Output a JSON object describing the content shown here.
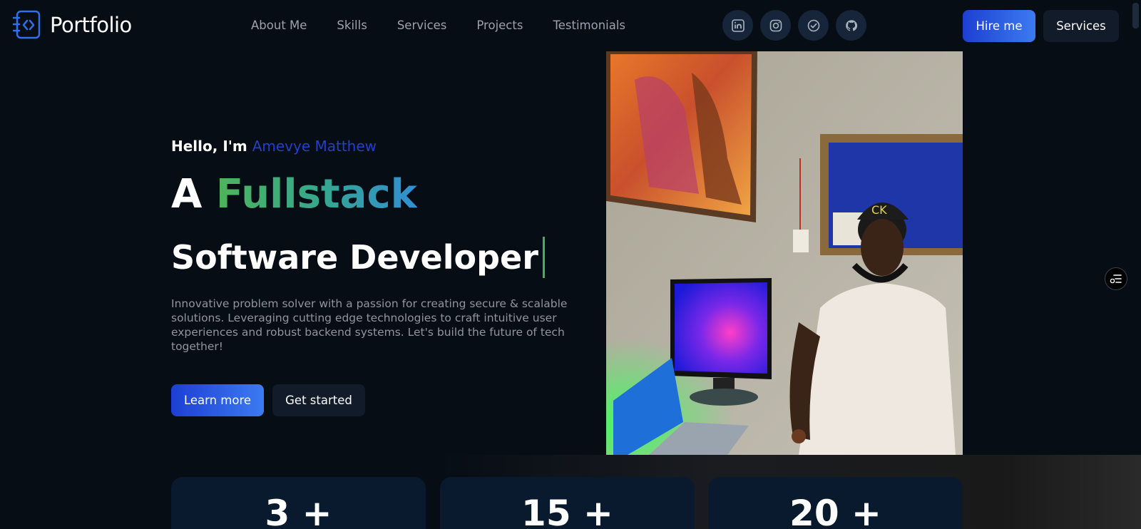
{
  "brand": {
    "name": "Portfolio",
    "icon": "code-file-icon"
  },
  "nav": {
    "items": [
      {
        "label": "About Me"
      },
      {
        "label": "Skills"
      },
      {
        "label": "Services"
      },
      {
        "label": "Projects"
      },
      {
        "label": "Testimonials"
      }
    ]
  },
  "socials": [
    {
      "icon": "linkedin-icon"
    },
    {
      "icon": "instagram-icon"
    },
    {
      "icon": "check-circle-icon"
    },
    {
      "icon": "github-icon"
    }
  ],
  "header_actions": {
    "hire_label": "Hire me",
    "services_label": "Services"
  },
  "hero": {
    "greeting": "Hello, I'm",
    "name": "Amevye Matthew",
    "line1_prefix": "A",
    "line1_highlight": "Fullstack",
    "line2": "Software Developer",
    "description": "Innovative problem solver with a passion for creating secure & scalable solutions. Leveraging cutting edge technologies to craft intuitive user experiences and robust backend systems. Let's build the future of tech together!",
    "learn_more_label": "Learn more",
    "get_started_label": "Get started"
  },
  "stats": [
    {
      "value": "3 +"
    },
    {
      "value": "15 +"
    },
    {
      "value": "20 +"
    }
  ],
  "colors": {
    "background": "#070d15",
    "accent_blue": "#2240c8",
    "gradient_green": "#4fb35a",
    "gradient_blue": "#2f8fd6",
    "card": "#0a1a2e"
  }
}
